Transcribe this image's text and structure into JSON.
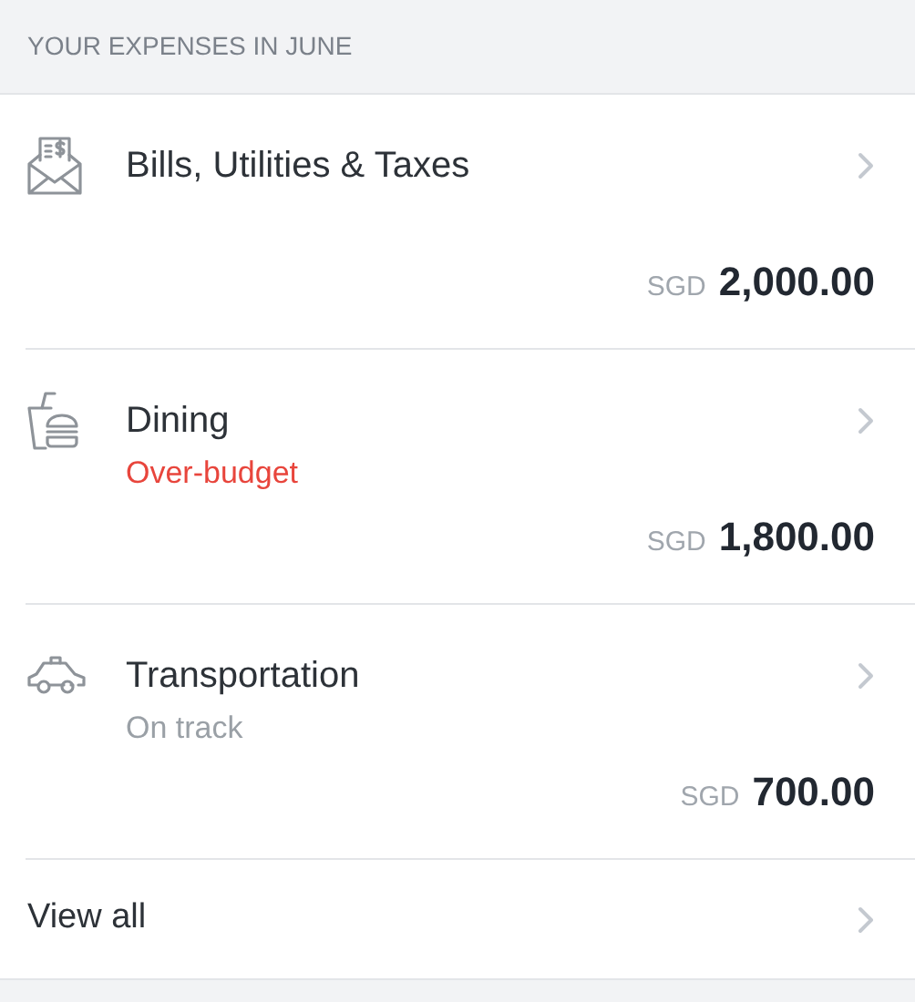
{
  "section_title": "YOUR EXPENSES IN JUNE",
  "expenses": [
    {
      "kind": "bills",
      "name": "Bills, Utilities & Taxes",
      "currency": "SGD",
      "amount": "2,000.00"
    },
    {
      "kind": "dining",
      "name": "Dining",
      "status": {
        "kind": "over",
        "text": "Over-budget"
      },
      "currency": "SGD",
      "amount": "1,800.00"
    },
    {
      "kind": "transport",
      "name": "Transportation",
      "status": {
        "kind": "ok",
        "text": "On track"
      },
      "currency": "SGD",
      "amount": "700.00"
    }
  ],
  "view_all": "View all"
}
